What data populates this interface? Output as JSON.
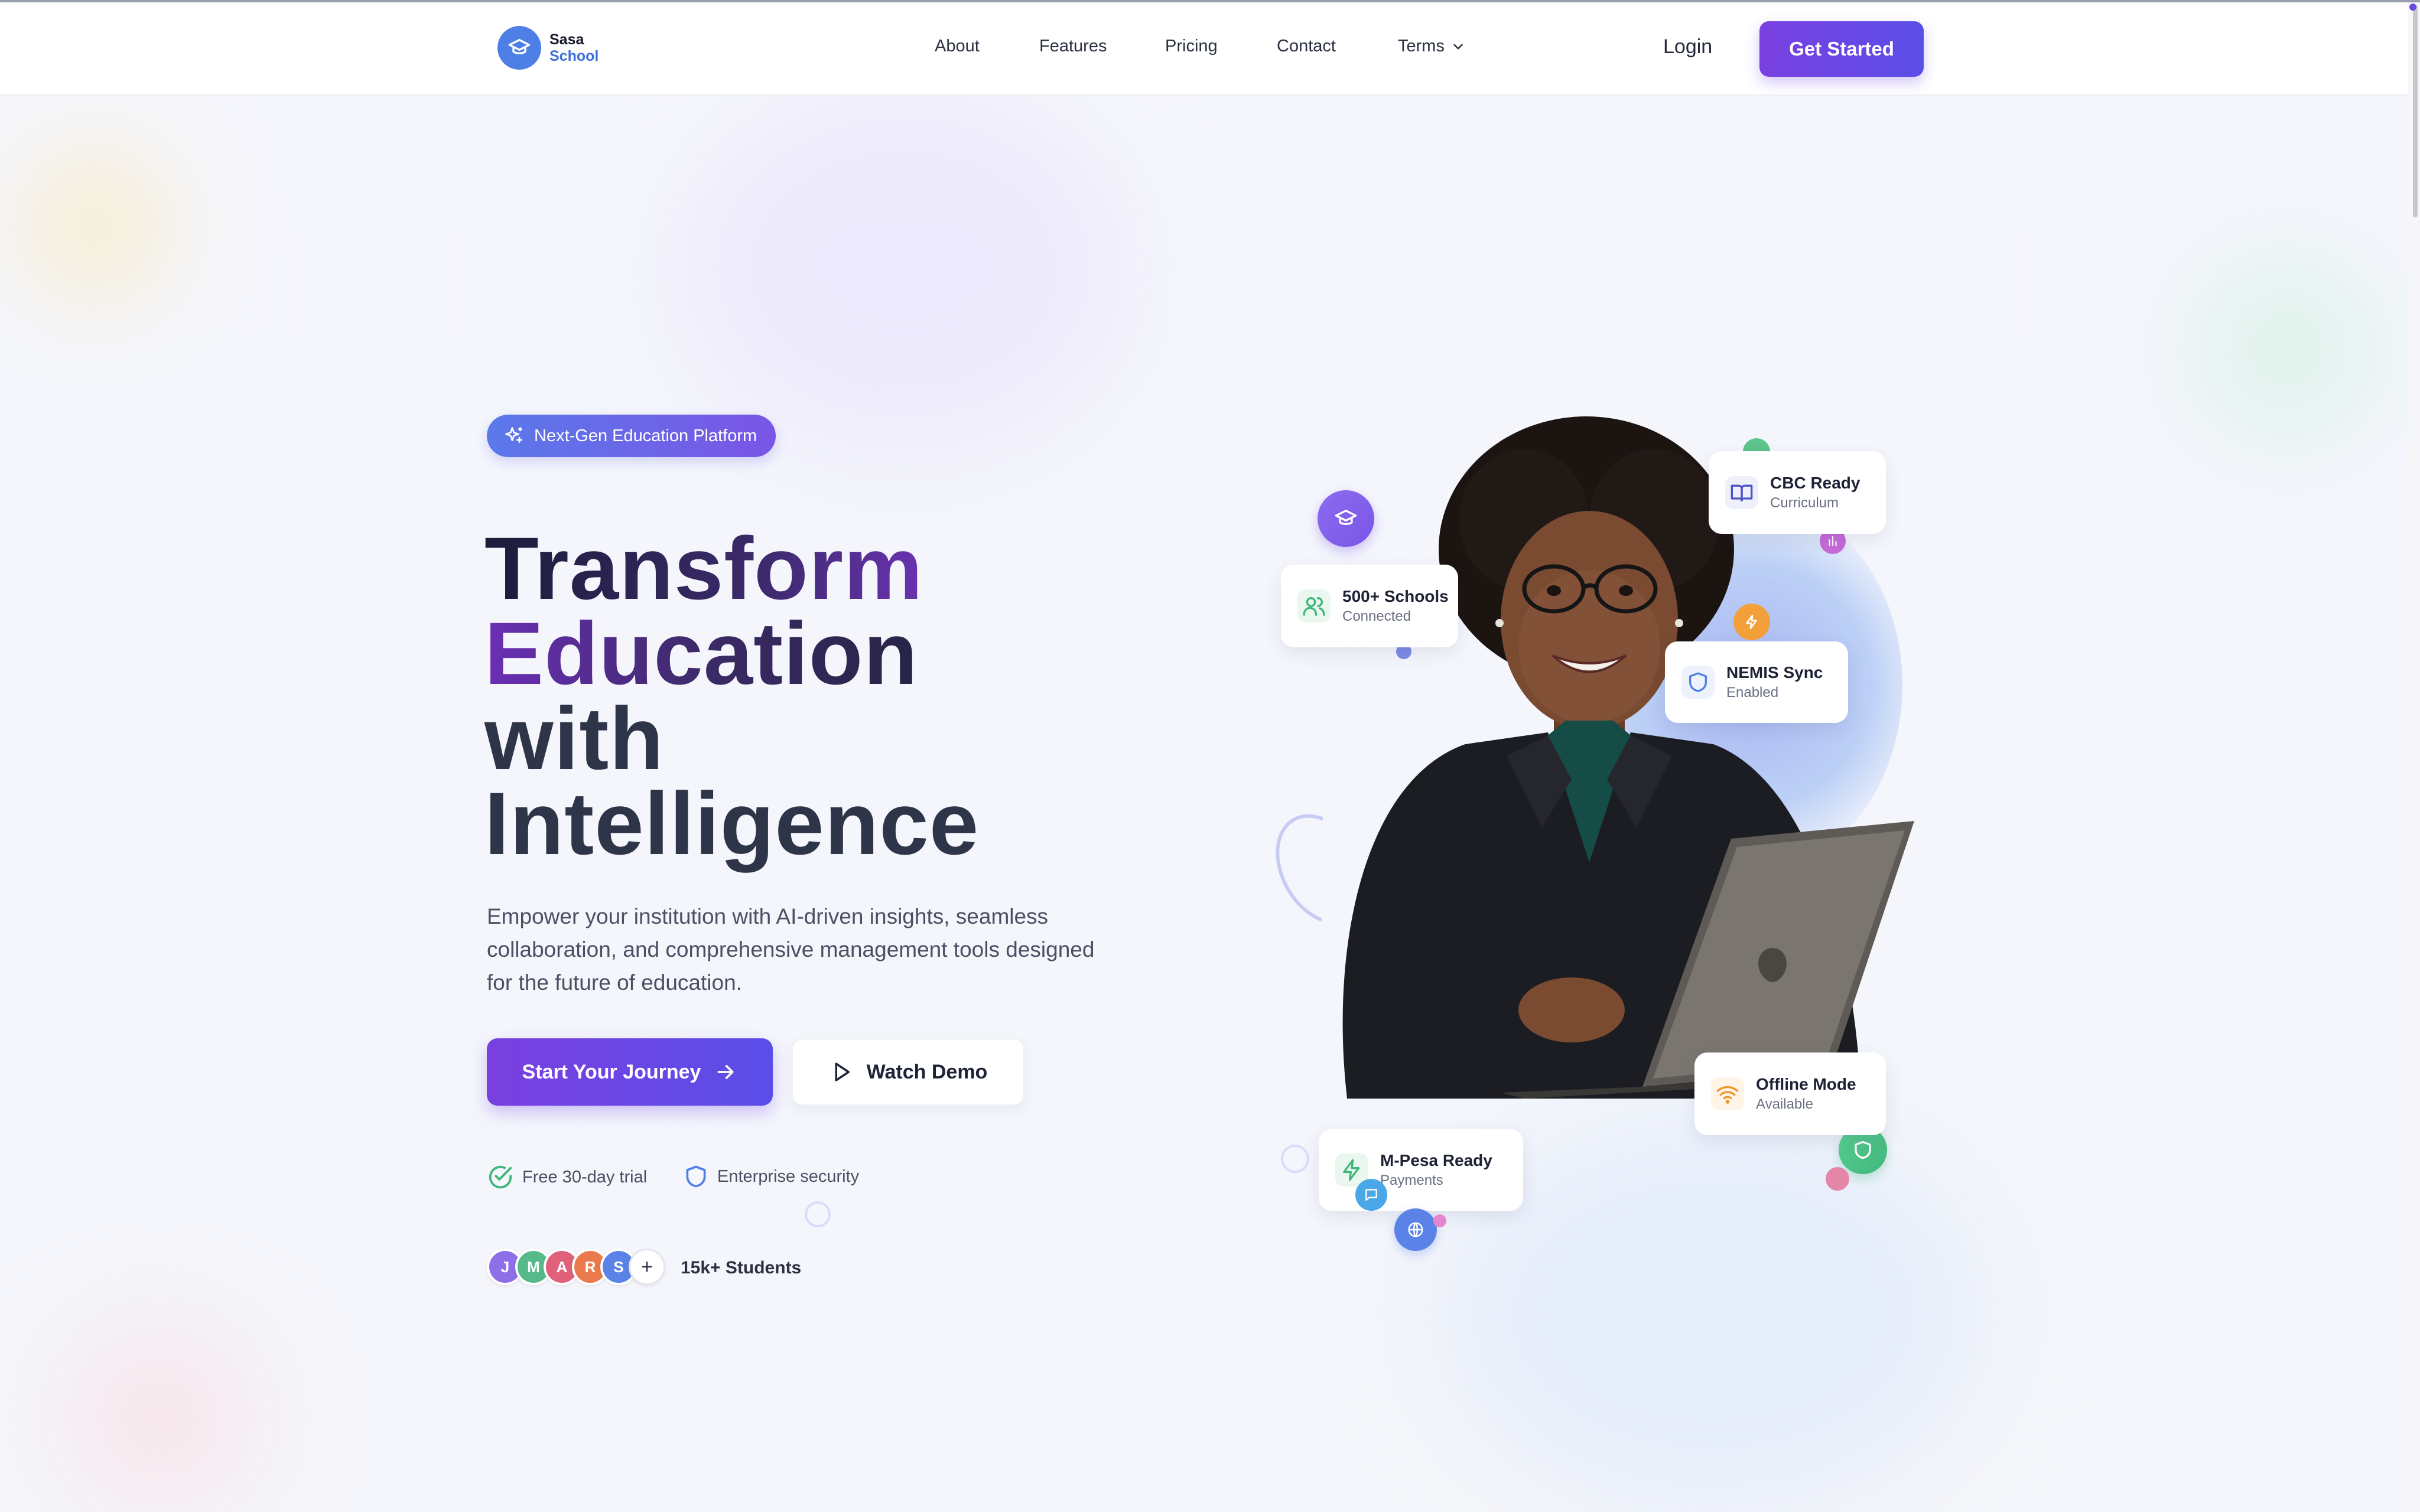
{
  "header": {
    "brand": {
      "line1": "Sasa",
      "line2": "School"
    },
    "nav": [
      {
        "label": "About"
      },
      {
        "label": "Features"
      },
      {
        "label": "Pricing"
      },
      {
        "label": "Contact"
      },
      {
        "label": "Terms"
      }
    ],
    "login_label": "Login",
    "cta_label": "Get Started"
  },
  "hero": {
    "badge": "Next-Gen Education Platform",
    "headline": [
      "Transform",
      "Education",
      "with",
      "Intelligence"
    ],
    "subtext": "Empower your institution with AI-driven insights, seamless collaboration, and comprehensive management tools designed for the future of education.",
    "primary_button": "Start Your Journey",
    "secondary_button": "Watch Demo",
    "trust": [
      {
        "label": "Free 30-day trial",
        "icon": "check-circle-icon"
      },
      {
        "label": "Enterprise security",
        "icon": "shield-icon"
      }
    ],
    "avatars": [
      "J",
      "M",
      "A",
      "R",
      "S",
      "+"
    ],
    "students_label": "15k+ Students"
  },
  "feature_cards": [
    {
      "title": "CBC Ready",
      "subtitle": "Curriculum",
      "icon": "book-icon"
    },
    {
      "title": "500+ Schools",
      "subtitle": "Connected",
      "icon": "users-icon"
    },
    {
      "title": "NEMIS Sync",
      "subtitle": "Enabled",
      "icon": "shield-icon"
    },
    {
      "title": "Offline Mode",
      "subtitle": "Available",
      "icon": "wifi-icon"
    },
    {
      "title": "M-Pesa Ready",
      "subtitle": "Payments",
      "icon": "lightning-icon"
    }
  ],
  "colors": {
    "accent_gradient": [
      "#7a3fe0",
      "#5a4ee8"
    ],
    "brand_blue": "#4d7fe6",
    "headline_dark": "#2f3548"
  }
}
